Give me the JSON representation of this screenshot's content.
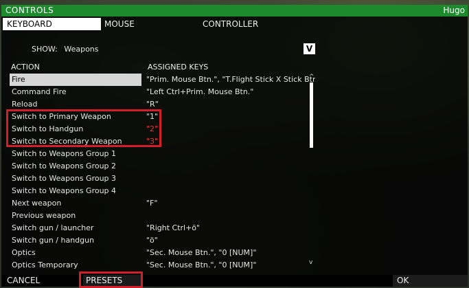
{
  "window": {
    "title": "CONTROLS",
    "user": "Hugo"
  },
  "tabs": [
    {
      "label": "KEYBOARD",
      "active": true
    },
    {
      "label": "MOUSE",
      "active": false
    },
    {
      "label": "CONTROLLER",
      "active": false
    }
  ],
  "show": {
    "label": "SHOW:",
    "value": "Weapons",
    "dropdown_icon": "V"
  },
  "table": {
    "headers": {
      "action": "ACTION",
      "keys": "ASSIGNED KEYS"
    },
    "rows": [
      {
        "action": "Fire",
        "keys": "\"Prim. Mouse Btn.\", \"T.Flight Stick X Stick Btn. #",
        "selected": true
      },
      {
        "action": "Command Fire",
        "keys": "\"Left Ctrl+Prim. Mouse Btn.\""
      },
      {
        "action": "Reload",
        "keys": "\"R\""
      },
      {
        "action": "Switch to Primary Weapon",
        "keys": "\"1\""
      },
      {
        "action": "Switch to Handgun",
        "keys": "\"2\"",
        "conflict": true
      },
      {
        "action": "Switch to Secondary Weapon",
        "keys": "\"3\"",
        "conflict": true
      },
      {
        "action": "Switch to Weapons Group 1",
        "keys": ""
      },
      {
        "action": "Switch to Weapons Group 2",
        "keys": ""
      },
      {
        "action": "Switch to Weapons Group 3",
        "keys": ""
      },
      {
        "action": "Switch to Weapons Group 4",
        "keys": ""
      },
      {
        "action": "Next weapon",
        "keys": "\"F\""
      },
      {
        "action": "Previous weapon",
        "keys": ""
      },
      {
        "action": "Switch gun / launcher",
        "keys": "\"Right Ctrl+ö\""
      },
      {
        "action": "Switch gun / handgun",
        "keys": "\"ö\""
      },
      {
        "action": "Optics",
        "keys": "\"Sec. Mouse Btn.\", \"0 [NUM]\""
      },
      {
        "action": "Optics Temporary",
        "keys": "\"Sec. Mouse Btn.\", \"0 [NUM]\""
      }
    ],
    "scroll_up_icon": "^",
    "scroll_down_icon": "v"
  },
  "footer": {
    "cancel": "CANCEL",
    "presets": "PRESETS",
    "ok": "OK"
  },
  "colors": {
    "title_green": "#1e8a2e",
    "conflict_red": "#e23a3a",
    "highlight_red": "#d0202a"
  }
}
